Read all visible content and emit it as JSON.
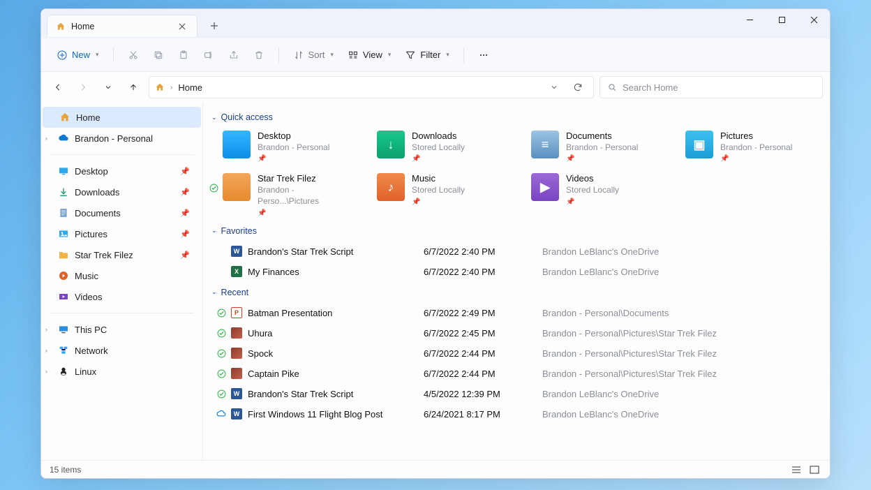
{
  "tab": {
    "title": "Home"
  },
  "toolbar": {
    "new": "New",
    "sort": "Sort",
    "view": "View",
    "filter": "Filter"
  },
  "address": {
    "location": "Home"
  },
  "search": {
    "placeholder": "Search Home"
  },
  "sidebar": {
    "home": "Home",
    "personal": "Brandon - Personal",
    "desktop": "Desktop",
    "downloads": "Downloads",
    "documents": "Documents",
    "pictures": "Pictures",
    "startrek": "Star Trek Filez",
    "music": "Music",
    "videos": "Videos",
    "thispc": "This PC",
    "network": "Network",
    "linux": "Linux"
  },
  "groups": {
    "quick": "Quick access",
    "favorites": "Favorites",
    "recent": "Recent"
  },
  "quick": [
    {
      "name": "Desktop",
      "loc": "Brandon - Personal",
      "color": "folder-blue",
      "glyph": ""
    },
    {
      "name": "Downloads",
      "loc": "Stored Locally",
      "color": "folder-teal",
      "glyph": "↓"
    },
    {
      "name": "Documents",
      "loc": "Brandon - Personal",
      "color": "folder-sky",
      "glyph": "≡"
    },
    {
      "name": "Pictures",
      "loc": "Brandon - Personal",
      "color": "folder-cyan",
      "glyph": "▣"
    },
    {
      "name": "Star Trek Filez",
      "loc": "Brandon - Perso...\\Pictures",
      "color": "folder-org",
      "glyph": "",
      "sync": true
    },
    {
      "name": "Music",
      "loc": "Stored Locally",
      "color": "folder-orange2",
      "glyph": "♪"
    },
    {
      "name": "Videos",
      "loc": "Stored Locally",
      "color": "folder-purple",
      "glyph": "▶"
    }
  ],
  "favorites": [
    {
      "icon": "W",
      "cls": "file-w",
      "name": "Brandon's Star Trek Script",
      "date": "6/7/2022 2:40 PM",
      "path": "Brandon LeBlanc's OneDrive"
    },
    {
      "icon": "X",
      "cls": "file-x",
      "name": "My Finances",
      "date": "6/7/2022 2:40 PM",
      "path": "Brandon LeBlanc's OneDrive"
    }
  ],
  "recent": [
    {
      "status": "synced",
      "icon": "P",
      "cls": "file-p",
      "name": "Batman Presentation",
      "date": "6/7/2022 2:49 PM",
      "path": "Brandon - Personal\\Documents"
    },
    {
      "status": "synced",
      "icon": "",
      "cls": "thumb",
      "name": "Uhura",
      "date": "6/7/2022 2:45 PM",
      "path": "Brandon - Personal\\Pictures\\Star Trek Filez"
    },
    {
      "status": "synced",
      "icon": "",
      "cls": "thumb",
      "name": "Spock",
      "date": "6/7/2022 2:44 PM",
      "path": "Brandon - Personal\\Pictures\\Star Trek Filez"
    },
    {
      "status": "synced",
      "icon": "",
      "cls": "thumb",
      "name": "Captain Pike",
      "date": "6/7/2022 2:44 PM",
      "path": "Brandon - Personal\\Pictures\\Star Trek Filez"
    },
    {
      "status": "synced",
      "icon": "W",
      "cls": "file-w",
      "name": "Brandon's Star Trek Script",
      "date": "4/5/2022 12:39 PM",
      "path": "Brandon LeBlanc's OneDrive"
    },
    {
      "status": "cloud",
      "icon": "W",
      "cls": "file-w",
      "name": "First Windows 11 Flight Blog Post",
      "date": "6/24/2021 8:17 PM",
      "path": "Brandon LeBlanc's OneDrive"
    }
  ],
  "status": {
    "items": "15 items"
  }
}
